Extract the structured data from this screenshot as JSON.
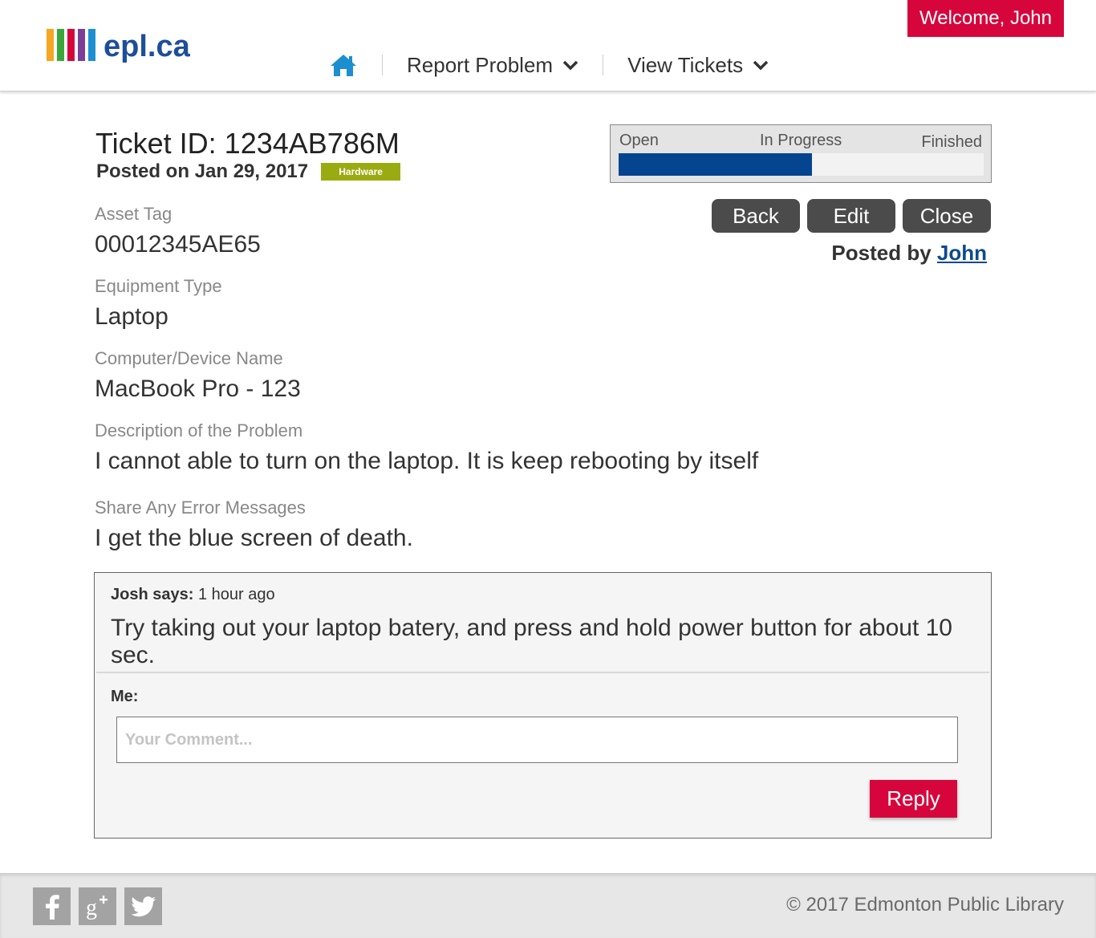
{
  "header": {
    "logo_text": "epl.ca",
    "logo_colors": [
      "#f5a623",
      "#3aa63a",
      "#d6063c",
      "#7b3f98",
      "#1d8fd1"
    ],
    "nav": {
      "home_icon": "home-icon",
      "report_problem": "Report Problem",
      "view_tickets": "View Tickets"
    },
    "welcome": "Welcome, John"
  },
  "ticket": {
    "id_line": "Ticket ID: 1234AB786M",
    "posted_on": "Posted on Jan 29, 2017",
    "category_badge": "Hardware",
    "status": {
      "labels": [
        "Open",
        "In Progress",
        "Finished"
      ],
      "progress_fraction": 0.53,
      "fill_color": "#05448f"
    },
    "actions": {
      "back": "Back",
      "edit": "Edit",
      "close": "Close"
    },
    "posted_by_prefix": "Posted by",
    "posted_by_name": "John",
    "fields": [
      {
        "label": "Asset Tag",
        "value": "00012345AE65"
      },
      {
        "label": "Equipment Type",
        "value": "Laptop"
      },
      {
        "label": "Computer/Device Name",
        "value": "MacBook Pro - 123"
      },
      {
        "label": "Description of the Problem",
        "value": "I cannot able to turn on the laptop. It is keep rebooting by itself"
      },
      {
        "label": "Share Any Error Messages",
        "value": "I get the blue screen of death."
      }
    ]
  },
  "comments": {
    "author": "Josh says:",
    "time": "1 hour ago",
    "text": "Try taking out your laptop batery, and press and hold power button for about 10 sec.",
    "me_label": "Me:",
    "input_placeholder": "Your Comment...",
    "reply": "Reply"
  },
  "footer": {
    "social_icons": [
      "facebook-icon",
      "google-plus-icon",
      "twitter-icon"
    ],
    "copyright": "© 2017 Edmonton Public Library"
  },
  "colors": {
    "accent_red": "#d6063c",
    "brand_blue": "#1d4e9c",
    "badge_green": "#9aab11",
    "button_dark": "#4b4b4b"
  }
}
